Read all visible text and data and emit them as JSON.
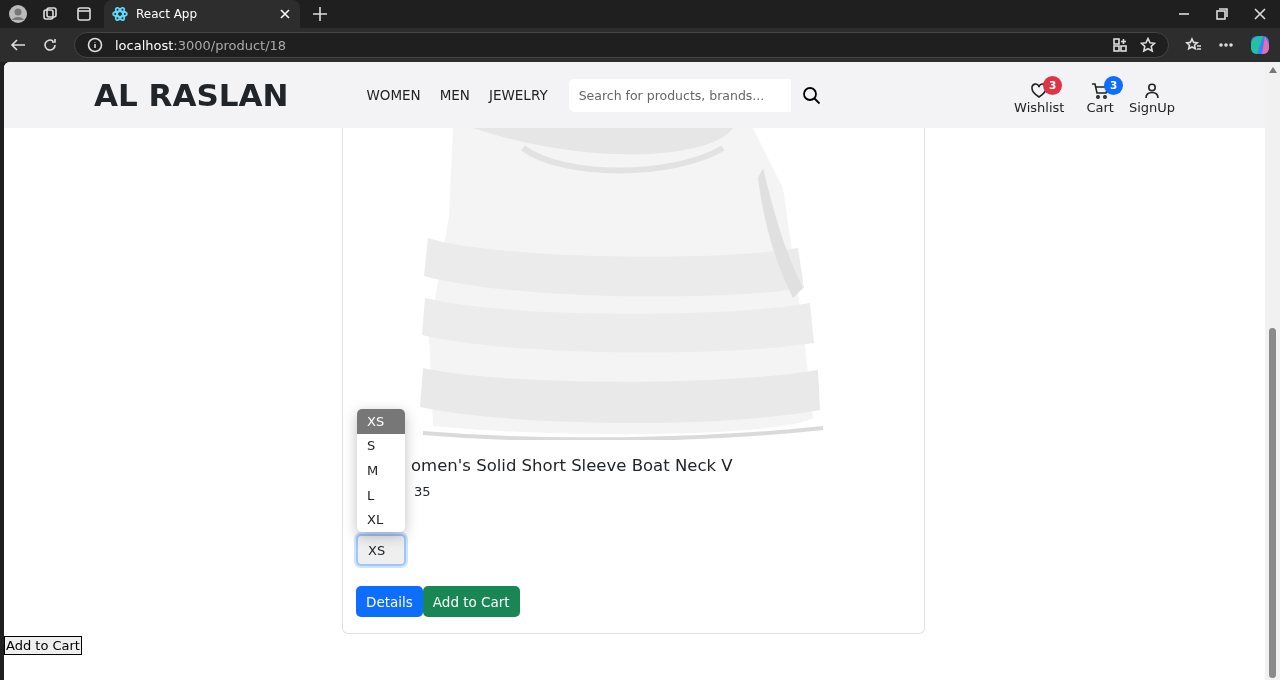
{
  "browser": {
    "tab_title": "React App",
    "url_host": "localhost",
    "url_path": ":3000/product/18"
  },
  "navbar": {
    "brand": "AL RASLAN",
    "links": [
      "WOMEN",
      "MEN",
      "JEWELRY"
    ],
    "search": {
      "placeholder": "Search for products, brands..."
    },
    "actions": [
      {
        "kind": "wishlist",
        "label": "Wishlist",
        "badge": "3",
        "color": "#dc3545"
      },
      {
        "kind": "cart",
        "label": "Cart",
        "badge": "3",
        "color": "#0d6efd"
      },
      {
        "kind": "user",
        "label": "SignUp"
      }
    ]
  },
  "product": {
    "title": "omen's Solid Short Sleeve Boat Neck V",
    "price": "35",
    "size_select": {
      "value": "XS",
      "expanded": true,
      "options": [
        {
          "label": "XS",
          "selected": true
        },
        {
          "label": "S",
          "selected": false
        },
        {
          "label": "M",
          "selected": false
        },
        {
          "label": "L",
          "selected": false
        },
        {
          "label": "XL",
          "selected": false
        }
      ]
    },
    "buttons": [
      {
        "kind": "primary",
        "label": "Details"
      },
      {
        "kind": "success",
        "label": "Add to Cart"
      }
    ]
  },
  "footer_button": "Add to Cart"
}
